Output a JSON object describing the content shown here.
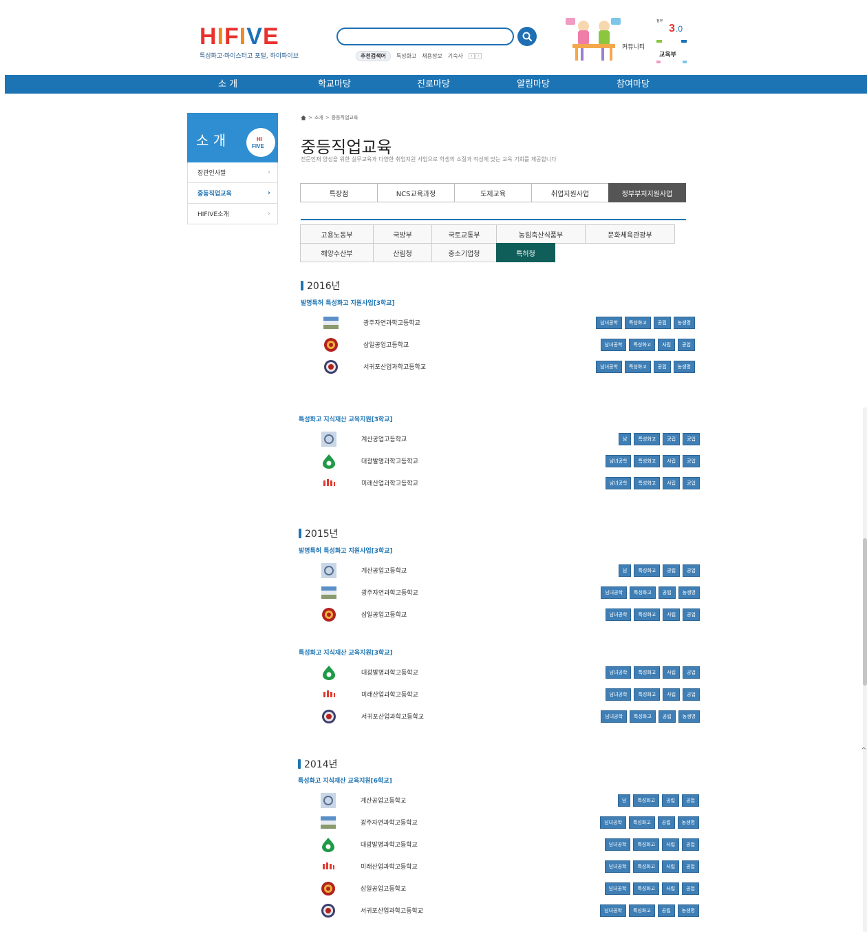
{
  "header": {
    "logo_text": "HIFIVE",
    "logo_sub": "특성화고·마이스터고 포털, 하이파이브",
    "search_placeholder": "",
    "keywords_label": "추천검색어",
    "keywords": [
      "특성화고",
      "채용정보",
      "기숙사"
    ],
    "community_label": "커뮤니티",
    "gov_badge_text": "교육부"
  },
  "gnb": [
    "소 개",
    "학교마당",
    "진로마당",
    "알림마당",
    "참여마당"
  ],
  "lnb": {
    "title": "소 개",
    "bubble": "HIFIVE",
    "items": [
      "장관인사말",
      "중등직업교육",
      "HIFIVE소개"
    ]
  },
  "breadcrumb": [
    "소개",
    "중등직업교육"
  ],
  "page": {
    "title": "중등직업교육",
    "desc": "전문인재 양성을 위한 실무교육과 다양한 취업지원 사업으로 학생의 소질과 적성에 맞는 교육 기회를 제공합니다"
  },
  "tabs1": [
    "특장점",
    "NCS교육과정",
    "도제교육",
    "취업지원사업",
    "정부부처지원사업"
  ],
  "tabs2_row1": [
    "고용노동부",
    "국방부",
    "국토교통부",
    "농림축산식품부",
    "문화체육관광부"
  ],
  "tabs2_row2": [
    "해양수산부",
    "산림청",
    "중소기업청",
    "특허청"
  ],
  "sections": {
    "y2016": {
      "year": "2016년",
      "s1": {
        "title": "발명특허 특성화고 지원사업[3학교]",
        "rows": [
          {
            "name": "광주자연과학고등학교",
            "tags": [
              "남녀공학",
              "특성화고",
              "공립",
              "농생명"
            ]
          },
          {
            "name": "삼일공업고등학교",
            "tags": [
              "남녀공학",
              "특성화고",
              "사립",
              "공업"
            ]
          },
          {
            "name": "서귀포산업과학고등학교",
            "tags": [
              "남녀공학",
              "특성화고",
              "공립",
              "농생명"
            ]
          }
        ]
      },
      "s2": {
        "title": "특성화고 지식재산 교육지원[3학교]",
        "rows": [
          {
            "name": "계산공업고등학교",
            "tags": [
              "남",
              "특성화고",
              "공립",
              "공업"
            ]
          },
          {
            "name": "대광발명과학고등학교",
            "tags": [
              "남녀공학",
              "특성화고",
              "사립",
              "공업"
            ]
          },
          {
            "name": "미래산업과학고등학교",
            "tags": [
              "남녀공학",
              "특성화고",
              "사립",
              "공업"
            ]
          }
        ]
      }
    },
    "y2015": {
      "year": "2015년",
      "s1": {
        "title": "발명특허 특성화고 지원사업[3학교]",
        "rows": [
          {
            "name": "계산공업고등학교",
            "tags": [
              "남",
              "특성화고",
              "공립",
              "공업"
            ]
          },
          {
            "name": "광주자연과학고등학교",
            "tags": [
              "남녀공학",
              "특성화고",
              "공립",
              "농생명"
            ]
          },
          {
            "name": "삼일공업고등학교",
            "tags": [
              "남녀공학",
              "특성화고",
              "사립",
              "공업"
            ]
          }
        ]
      },
      "s2": {
        "title": "특성화고 지식재산 교육지원[3학교]",
        "rows": [
          {
            "name": "대광발명과학고등학교",
            "tags": [
              "남녀공학",
              "특성화고",
              "사립",
              "공업"
            ]
          },
          {
            "name": "미래산업과학고등학교",
            "tags": [
              "남녀공학",
              "특성화고",
              "사립",
              "공업"
            ]
          },
          {
            "name": "서귀포산업과학고등학교",
            "tags": [
              "남녀공학",
              "특성화고",
              "공립",
              "농생명"
            ]
          }
        ]
      }
    },
    "y2014": {
      "year": "2014년",
      "s1": {
        "title": "특성화고 지식재산 교육지원[6학교]",
        "rows": [
          {
            "name": "계산공업고등학교",
            "tags": [
              "남",
              "특성화고",
              "공립",
              "공업"
            ]
          },
          {
            "name": "광주자연과학고등학교",
            "tags": [
              "남녀공학",
              "특성화고",
              "공립",
              "농생명"
            ]
          },
          {
            "name": "대광발명과학고등학교",
            "tags": [
              "남녀공학",
              "특성화고",
              "사립",
              "공업"
            ]
          },
          {
            "name": "미래산업과학고등학교",
            "tags": [
              "남녀공학",
              "특성화고",
              "사립",
              "공업"
            ]
          },
          {
            "name": "삼일공업고등학교",
            "tags": [
              "남녀공학",
              "특성화고",
              "사립",
              "공업"
            ]
          },
          {
            "name": "서귀포산업과학고등학교",
            "tags": [
              "남녀공학",
              "특성화고",
              "공립",
              "농생명"
            ]
          }
        ]
      }
    }
  },
  "colors": {
    "brand_blue": "#1d74b4",
    "active_tab": "#0f5e5a",
    "tag_bg": "#3f7fb5"
  }
}
